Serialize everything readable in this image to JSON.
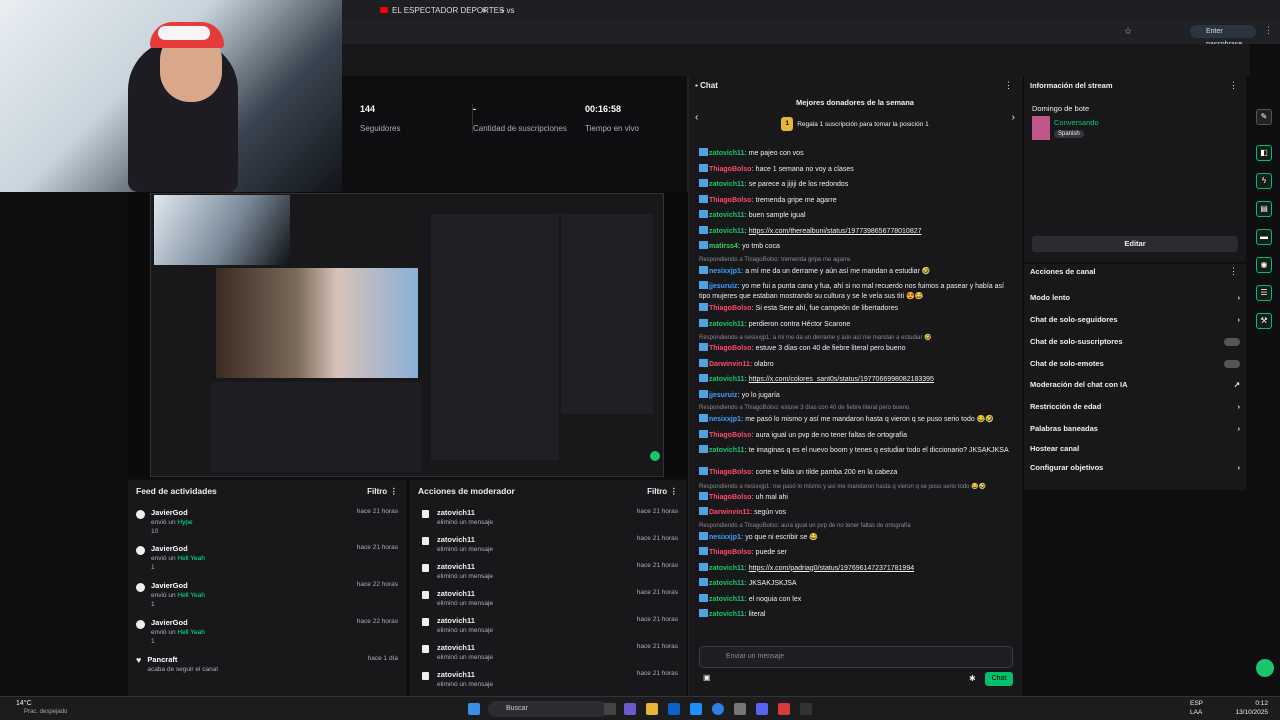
{
  "browser": {
    "tab_title": "EL ESPECTADOR DEPORTES vs",
    "tab_close": "×",
    "new_tab": "+",
    "passphrase": "Enter passphrase"
  },
  "stats": {
    "items": [
      {
        "value": "144",
        "label": "Seguidores"
      },
      {
        "value": "-",
        "label": "Cantidad de suscripciones"
      },
      {
        "value": "00:16:58",
        "label": "Tiempo en vivo"
      }
    ]
  },
  "feed": {
    "title": "Feed de actividades",
    "filter": "Filtro",
    "items": [
      {
        "name": "JavierGod",
        "action": "envió un",
        "item": "Hype",
        "count": "10",
        "time": "hace 21 horas"
      },
      {
        "name": "JavierGod",
        "action": "envió un",
        "item": "Hell Yeah",
        "count": "1",
        "time": "hace 21 horas"
      },
      {
        "name": "JavierGod",
        "action": "envió un",
        "item": "Hell Yeah",
        "count": "1",
        "time": "hace 22 horas"
      },
      {
        "name": "JavierGod",
        "action": "envió un",
        "item": "Hell Yeah",
        "count": "1",
        "time": "hace 22 horas"
      },
      {
        "name": "Pancraft",
        "action": "acaba de seguir el canal",
        "item": "",
        "count": "",
        "time": "hace 1 día"
      }
    ]
  },
  "mod": {
    "title": "Acciones de moderador",
    "filter": "Filtro",
    "items": [
      {
        "name": "zatovich11",
        "action": "eliminó un mensaje",
        "time": "hace 21 horas"
      },
      {
        "name": "zatovich11",
        "action": "eliminó un mensaje",
        "time": "hace 21 horas"
      },
      {
        "name": "zatovich11",
        "action": "eliminó un mensaje",
        "time": "hace 21 horas"
      },
      {
        "name": "zatovich11",
        "action": "eliminó un mensaje",
        "time": "hace 21 horas"
      },
      {
        "name": "zatovich11",
        "action": "eliminó un mensaje",
        "time": "hace 21 horas"
      },
      {
        "name": "zatovich11",
        "action": "eliminó un mensaje",
        "time": "hace 21 horas"
      },
      {
        "name": "zatovich11",
        "action": "eliminó un mensaje",
        "time": "hace 21 horas"
      }
    ]
  },
  "chat": {
    "title": "Chat",
    "donors_title": "Mejores donadores de la semana",
    "donors_sub": "Regala 1 suscripción para tomar la posición 1",
    "rank": "1",
    "input_placeholder": "Enviar un mensaje",
    "send": "Chat",
    "lines": [
      {
        "user": "zatovich11:",
        "msg": "me pajeo con vos",
        "color": "#19c46a"
      },
      {
        "user": "ThiagoBolso:",
        "msg": "hace 1 semana no voy a clases",
        "color": "#ff4a6e"
      },
      {
        "user": "zatovich11:",
        "msg": "se parece a jijiji de los redondos",
        "color": "#19c46a"
      },
      {
        "user": "ThiagoBolso:",
        "msg": "tremenda gripe me agarre",
        "color": "#ff4a6e"
      },
      {
        "user": "zatovich11:",
        "msg": "buen sample igual",
        "color": "#19c46a"
      },
      {
        "user": "zatovich11:",
        "msg": "https://x.com/therealbuni/status/1977398656778010827",
        "color": "#19c46a",
        "link": true
      },
      {
        "user": "matirss4:",
        "msg": "yo tmb coca",
        "color": "#3ad35a"
      },
      {
        "reply": "Respondiendo a ThiagoBolso: tremenda gripe me agarre"
      },
      {
        "user": "nesixxjp1:",
        "msg": "a mí me da un derrame y aún así me mandan a estudiar 🤣",
        "color": "#3fa0ff"
      },
      {
        "user": "jjesuruiz:",
        "msg": "yo me fui a punta cana y fua, ahí si no mal recuerdo nos fuimos a pasear y había así tipo mujeres que estaban mostrando su cultura y se le veía sus titi 😍😂",
        "color": "#3fa0ff",
        "two": true
      },
      {
        "user": "ThiagoBolso:",
        "msg": "Si esta Sere ahí, fue campeón de libertadores",
        "color": "#ff4a6e"
      },
      {
        "user": "zatovich11:",
        "msg": "perdieron contra Héctor Scarone",
        "color": "#19c46a"
      },
      {
        "reply": "Respondiendo a nesixxjp1: a mí me da un derrame y aún así me mandan a estudiar 🤣"
      },
      {
        "user": "ThiagoBolso:",
        "msg": "estuve 3 días con 40 de fiebre literal pero bueno",
        "color": "#ff4a6e"
      },
      {
        "user": "Darwinvin11:",
        "msg": "olabro",
        "color": "#ff4a6e"
      },
      {
        "user": "zatovich11:",
        "msg": "https://x.com/colores_sant0s/status/1977066998082183395",
        "color": "#19c46a",
        "link": true
      },
      {
        "user": "jjesuruiz:",
        "msg": "yo lo jugaría",
        "color": "#3fa0ff"
      },
      {
        "reply": "Respondiendo a ThiagoBolso: estuve 3 días con 40 de fiebre literal pero bueno"
      },
      {
        "user": "nesixxjp1:",
        "msg": "me pasó lo mismo y así me mandaron hasta q vieron q se puso serio todo 😂🤣",
        "color": "#3fa0ff"
      },
      {
        "user": "ThiagoBolso:",
        "msg": "aura igual un pvp de no tener faltas de ortografía",
        "color": "#ff4a6e"
      },
      {
        "user": "zatovich11:",
        "msg": "te imaginas q es el nuevo boom y tenes q estudiar todo el diccionario? JKSAKJKSA",
        "color": "#19c46a",
        "two": true
      },
      {
        "user": "ThiagoBolso:",
        "msg": "corte te falta un tilde pamba 200 en la cabeza",
        "color": "#ff4a6e"
      },
      {
        "reply": "Respondiendo a nesixxjp1: me pasó lo mismo y así me mandaron hasta q vieron q se puso serio todo 😂🤣"
      },
      {
        "user": "ThiagoBolso:",
        "msg": "uh mal ahi",
        "color": "#ff4a6e"
      },
      {
        "user": "Darwinvin11:",
        "msg": "según vos",
        "color": "#ff4a6e"
      },
      {
        "reply": "Respondiendo a ThiagoBolso: aura igual un pvp de no tener faltas de ortografía"
      },
      {
        "user": "nesixxjp1:",
        "msg": "yo que ni escribir se 😂",
        "color": "#3fa0ff"
      },
      {
        "user": "ThiagoBolso:",
        "msg": "puede ser",
        "color": "#ff4a6e"
      },
      {
        "user": "zatovich11:",
        "msg": "https://x.com/padriag0/status/1976961472371781994",
        "color": "#19c46a",
        "link": true
      },
      {
        "user": "zatovich11:",
        "msg": "JKSAKJSKJSA",
        "color": "#19c46a"
      },
      {
        "user": "zatovich11:",
        "msg": "el noquia con lex",
        "color": "#19c46a"
      },
      {
        "user": "zatovich11:",
        "msg": "literal",
        "color": "#19c46a"
      }
    ]
  },
  "info": {
    "title": "Información del stream",
    "stream_title": "Domingo de bote",
    "category": "Conversando",
    "tag": "Spanish",
    "edit": "Editar"
  },
  "acciones": {
    "title": "Acciones de canal",
    "rows": [
      "Modo lento",
      "Chat de solo-seguidores",
      "Chat de solo-suscriptores",
      "Chat de solo-emotes",
      "Moderación del chat con IA",
      "Restricción de edad",
      "Palabras baneadas",
      "Hostear canal",
      "Configurar objetivos"
    ]
  },
  "taskbar": {
    "temp": "14°C",
    "weather": "Prac. despejado",
    "search": "Buscar",
    "lang": "ESP",
    "lang2": "LAA",
    "time": "0:12",
    "date": "13/10/2025"
  }
}
